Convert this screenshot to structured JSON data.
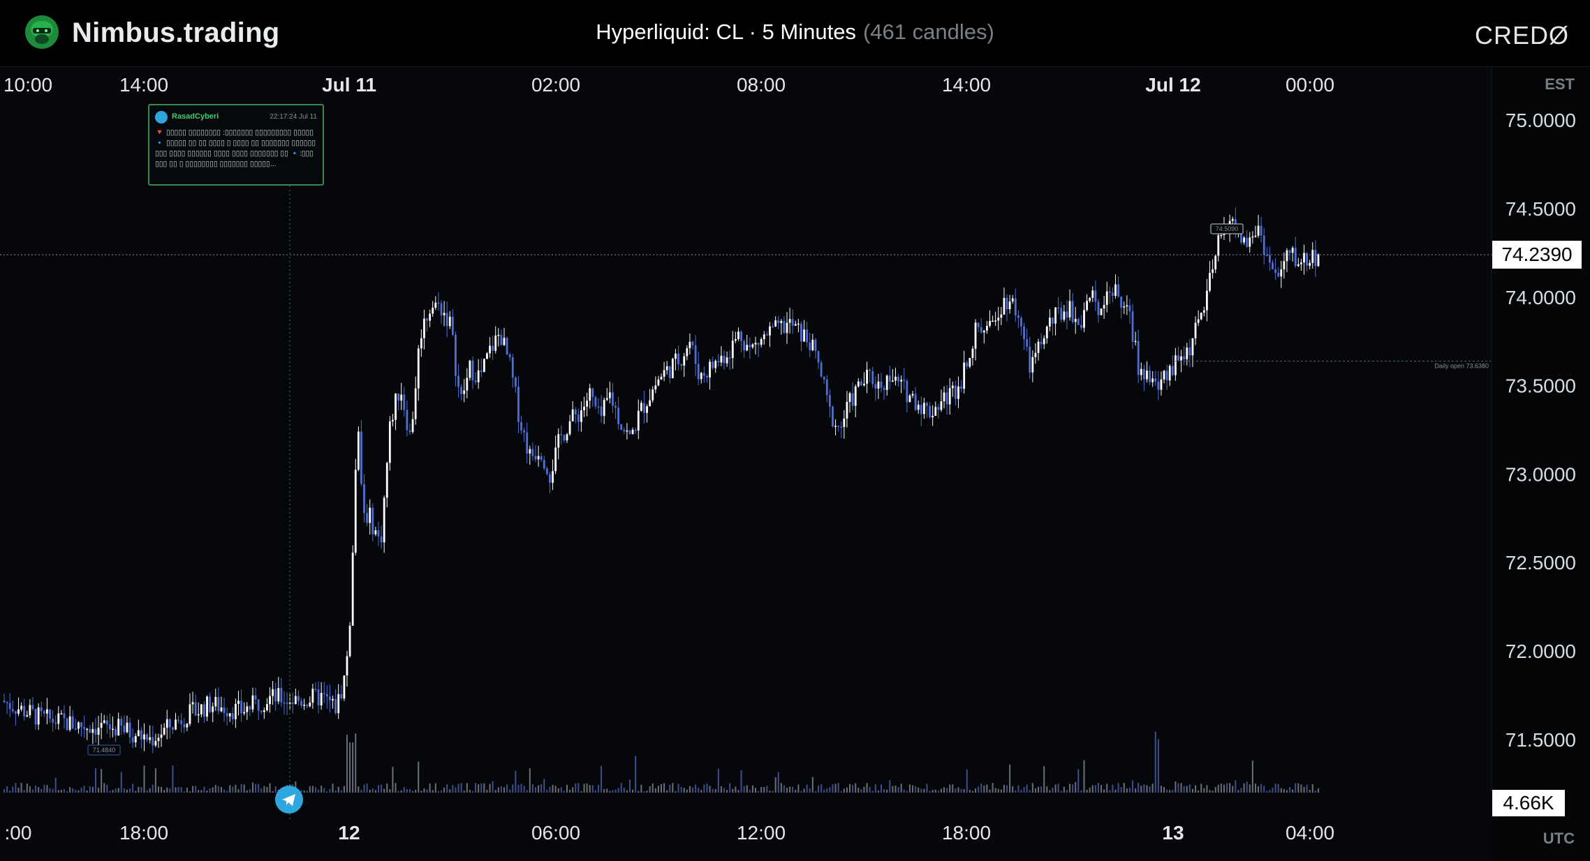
{
  "header": {
    "brand": "Nimbus.trading",
    "title": "Hyperliquid: CL · 5 Minutes",
    "candle_count": "(461 candles)",
    "right_logo": "CREDØ"
  },
  "axes": {
    "top_timezone": "EST",
    "bottom_timezone": "UTC",
    "top_ticks": [
      {
        "label": "10:00",
        "bold": false
      },
      {
        "label": "14:00",
        "bold": false
      },
      {
        "label": "Jul 11",
        "bold": true
      },
      {
        "label": "02:00",
        "bold": false
      },
      {
        "label": "08:00",
        "bold": false
      },
      {
        "label": "14:00",
        "bold": false
      },
      {
        "label": "Jul 12",
        "bold": true
      },
      {
        "label": "00:00",
        "bold": false
      }
    ],
    "bottom_ticks": [
      {
        "label": ":00",
        "bold": false
      },
      {
        "label": "18:00",
        "bold": false
      },
      {
        "label": "12",
        "bold": true
      },
      {
        "label": "06:00",
        "bold": false
      },
      {
        "label": "12:00",
        "bold": false
      },
      {
        "label": "18:00",
        "bold": false
      },
      {
        "label": "13",
        "bold": true
      },
      {
        "label": "04:00",
        "bold": false
      }
    ],
    "price_ticks": [
      "75.0000",
      "74.5000",
      "74.0000",
      "73.5000",
      "73.0000",
      "72.5000",
      "72.0000",
      "71.5000"
    ]
  },
  "badges": {
    "last_price": "74.2390",
    "volume": "4.66K",
    "high_label": "74.5090",
    "low_label": "71.4840",
    "daily_open_label": "Daily open 73.6380"
  },
  "news": {
    "author": "RasadCyberi",
    "time": "22:17:24 Jul 11",
    "text": "🔻 ▯▯▯▯▯ ▯▯▯▯▯▯▯▯ :▯▯▯▯▯▯▯ ▯▯▯▯▯▯▯▯▯ ▯▯▯▯▯ 🔹 ▯▯▯▯▯ ▯▯ ▯▯ ▯▯▯▯ ▯ ▯▯▯▯ ▯▯ ▯▯▯▯▯▯▯ ▯▯▯▯▯▯▯▯▯ ▯▯▯▯ ▯▯▯▯▯▯ ▯▯▯▯ ▯▯▯▯ ▯▯▯▯▯▯▯ ▯▯ 🔹:▯▯▯▯▯▯ ▯▯ ▯ ▯▯▯▯▯▯▯▯ ▯▯▯▯▯▯▯ ▯▯▯▯▯..."
  },
  "colors": {
    "up": "#ffffff",
    "down": "#4f6fd6",
    "wick": "#c9d2ea",
    "news_border": "#3a8a4f",
    "telegram": "#2ea6de"
  },
  "chart_data": {
    "type": "candlestick",
    "instrument": "CL",
    "exchange": "Hyperliquid",
    "interval": "5 Minutes",
    "candles": 461,
    "y_range": [
      71.2,
      75.3
    ],
    "last_price": 74.239,
    "session_high": 74.509,
    "session_low": 71.484,
    "daily_open": 73.638,
    "last_volume": "4.66K",
    "price_path": [
      [
        0,
        71.72
      ],
      [
        20,
        71.62
      ],
      [
        40,
        71.58
      ],
      [
        60,
        71.56
      ],
      [
        75,
        71.5
      ],
      [
        90,
        71.62
      ],
      [
        105,
        71.7
      ],
      [
        120,
        71.66
      ],
      [
        135,
        71.74
      ],
      [
        150,
        71.72
      ],
      [
        160,
        71.74
      ],
      [
        168,
        71.68
      ],
      [
        172,
        71.85
      ],
      [
        175,
        72.2
      ],
      [
        177,
        72.9
      ],
      [
        179,
        73.3
      ],
      [
        181,
        72.8
      ],
      [
        185,
        72.75
      ],
      [
        190,
        72.6
      ],
      [
        195,
        73.3
      ],
      [
        200,
        73.5
      ],
      [
        205,
        73.2
      ],
      [
        210,
        73.8
      ],
      [
        215,
        73.95
      ],
      [
        220,
        73.95
      ],
      [
        225,
        73.85
      ],
      [
        230,
        73.4
      ],
      [
        235,
        73.6
      ],
      [
        240,
        73.55
      ],
      [
        245,
        73.7
      ],
      [
        250,
        73.8
      ],
      [
        255,
        73.6
      ],
      [
        260,
        73.3
      ],
      [
        265,
        73.1
      ],
      [
        270,
        73.15
      ],
      [
        275,
        73.0
      ],
      [
        280,
        73.2
      ],
      [
        285,
        73.3
      ],
      [
        290,
        73.35
      ],
      [
        295,
        73.45
      ],
      [
        300,
        73.3
      ],
      [
        305,
        73.45
      ],
      [
        310,
        73.3
      ],
      [
        315,
        73.2
      ],
      [
        320,
        73.35
      ],
      [
        325,
        73.45
      ],
      [
        330,
        73.55
      ],
      [
        335,
        73.6
      ],
      [
        340,
        73.65
      ],
      [
        345,
        73.75
      ],
      [
        350,
        73.55
      ],
      [
        355,
        73.6
      ],
      [
        360,
        73.65
      ],
      [
        365,
        73.7
      ],
      [
        370,
        73.8
      ],
      [
        375,
        73.7
      ],
      [
        380,
        73.75
      ],
      [
        385,
        73.8
      ],
      [
        390,
        73.82
      ],
      [
        395,
        73.85
      ],
      [
        400,
        73.8
      ],
      [
        405,
        73.75
      ],
      [
        410,
        73.6
      ],
      [
        415,
        73.35
      ],
      [
        420,
        73.25
      ],
      [
        425,
        73.4
      ],
      [
        430,
        73.5
      ],
      [
        435,
        73.55
      ],
      [
        440,
        73.5
      ],
      [
        445,
        73.55
      ],
      [
        450,
        73.5
      ],
      [
        455,
        73.45
      ],
      [
        460,
        73.4
      ],
      [
        465,
        73.35
      ],
      [
        470,
        73.4
      ],
      [
        475,
        73.45
      ],
      [
        480,
        73.5
      ],
      [
        485,
        73.7
      ],
      [
        490,
        73.85
      ],
      [
        495,
        73.8
      ],
      [
        500,
        73.95
      ],
      [
        505,
        74.0
      ],
      [
        510,
        73.9
      ],
      [
        515,
        73.6
      ],
      [
        520,
        73.7
      ],
      [
        525,
        73.85
      ],
      [
        530,
        73.9
      ],
      [
        535,
        73.95
      ],
      [
        540,
        73.85
      ],
      [
        545,
        74.0
      ],
      [
        550,
        73.95
      ],
      [
        555,
        74.05
      ],
      [
        560,
        74.0
      ],
      [
        565,
        73.9
      ],
      [
        570,
        73.6
      ],
      [
        575,
        73.55
      ],
      [
        580,
        73.5
      ],
      [
        585,
        73.55
      ],
      [
        590,
        73.65
      ],
      [
        595,
        73.7
      ],
      [
        600,
        73.85
      ],
      [
        605,
        74.05
      ],
      [
        610,
        74.3
      ],
      [
        615,
        74.45
      ],
      [
        620,
        74.35
      ],
      [
        625,
        74.3
      ],
      [
        630,
        74.4
      ],
      [
        635,
        74.2
      ],
      [
        640,
        74.1
      ],
      [
        645,
        74.25
      ],
      [
        650,
        74.2
      ],
      [
        655,
        74.22
      ],
      [
        660,
        74.24
      ]
    ]
  }
}
